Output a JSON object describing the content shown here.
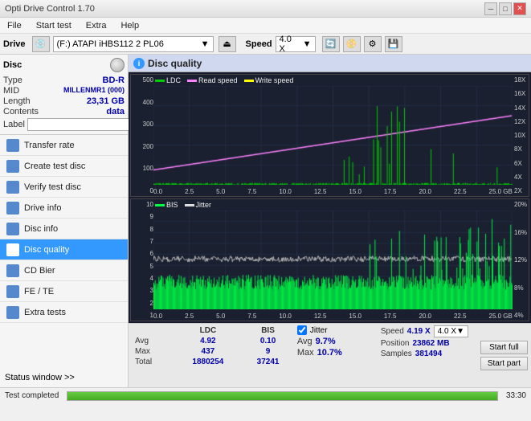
{
  "titlebar": {
    "title": "Opti Drive Control 1.70",
    "controls": [
      "minimize",
      "maximize",
      "close"
    ]
  },
  "menubar": {
    "items": [
      "File",
      "Start test",
      "Extra",
      "Help"
    ]
  },
  "drivebar": {
    "label": "Drive",
    "drive_value": "(F:)  ATAPI iHBS112  2 PL06",
    "speed_label": "Speed",
    "speed_value": "4.0 X"
  },
  "sidebar": {
    "disc_section": {
      "type_label": "Type",
      "type_value": "BD-R",
      "mid_label": "MID",
      "mid_value": "MILLENMR1 (000)",
      "length_label": "Length",
      "length_value": "23,31 GB",
      "contents_label": "Contents",
      "contents_value": "data",
      "label_label": "Label"
    },
    "nav_items": [
      {
        "id": "transfer-rate",
        "label": "Transfer rate",
        "active": false
      },
      {
        "id": "create-test-disc",
        "label": "Create test disc",
        "active": false
      },
      {
        "id": "verify-test-disc",
        "label": "Verify test disc",
        "active": false
      },
      {
        "id": "drive-info",
        "label": "Drive info",
        "active": false
      },
      {
        "id": "disc-info",
        "label": "Disc info",
        "active": false
      },
      {
        "id": "disc-quality",
        "label": "Disc quality",
        "active": true
      },
      {
        "id": "cd-bier",
        "label": "CD Bier",
        "active": false
      },
      {
        "id": "fe-te",
        "label": "FE / TE",
        "active": false
      },
      {
        "id": "extra-tests",
        "label": "Extra tests",
        "active": false
      }
    ],
    "status_window": "Status window >>"
  },
  "disc_quality": {
    "title": "Disc quality",
    "chart1": {
      "legend": [
        {
          "name": "LDC",
          "color": "#00ff00"
        },
        {
          "name": "Read speed",
          "color": "#ff80ff"
        },
        {
          "name": "Write speed",
          "color": "#ffff00"
        }
      ],
      "y_left": [
        "500",
        "400",
        "300",
        "200",
        "100",
        "0"
      ],
      "y_right": [
        "18X",
        "16X",
        "14X",
        "12X",
        "10X",
        "8X",
        "6X",
        "4X",
        "2X"
      ],
      "x_labels": [
        "0.0",
        "2.5",
        "5.0",
        "7.5",
        "10.0",
        "12.5",
        "15.0",
        "17.5",
        "20.0",
        "22.5",
        "25.0 GB"
      ]
    },
    "chart2": {
      "legend": [
        {
          "name": "BIS",
          "color": "#00ff00"
        },
        {
          "name": "Jitter",
          "color": "#ffffff"
        }
      ],
      "y_left": [
        "10",
        "9",
        "8",
        "7",
        "6",
        "5",
        "4",
        "3",
        "2",
        "1"
      ],
      "y_right": [
        "20%",
        "16%",
        "12%",
        "8%",
        "4%"
      ],
      "x_labels": [
        "0.0",
        "2.5",
        "5.0",
        "7.5",
        "10.0",
        "12.5",
        "15.0",
        "17.5",
        "20.0",
        "22.5",
        "25.0 GB"
      ]
    },
    "stats": {
      "columns": [
        "",
        "LDC",
        "BIS"
      ],
      "rows": [
        {
          "label": "Avg",
          "ldc": "4.92",
          "bis": "0.10"
        },
        {
          "label": "Max",
          "ldc": "437",
          "bis": "9"
        },
        {
          "label": "Total",
          "ldc": "1880254",
          "bis": "37241"
        }
      ],
      "jitter_checked": true,
      "jitter_label": "Jitter",
      "jitter_avg": "9.7%",
      "jitter_max": "10.7%",
      "speed_label": "Speed",
      "speed_value": "4.19 X",
      "speed_select": "4.0 X",
      "position_label": "Position",
      "position_value": "23862 MB",
      "samples_label": "Samples",
      "samples_value": "381494",
      "start_full": "Start full",
      "start_part": "Start part"
    }
  },
  "bottom_bar": {
    "status": "Test completed",
    "progress": 100,
    "time": "33:30"
  },
  "colors": {
    "accent_blue": "#3399ff",
    "ldc_color": "#00cc00",
    "bis_color": "#00ff44",
    "readspeed_color": "#ff80ff",
    "jitter_color": "#dddddd",
    "grid_color": "#2a3050",
    "bg_chart": "#1a2030"
  }
}
